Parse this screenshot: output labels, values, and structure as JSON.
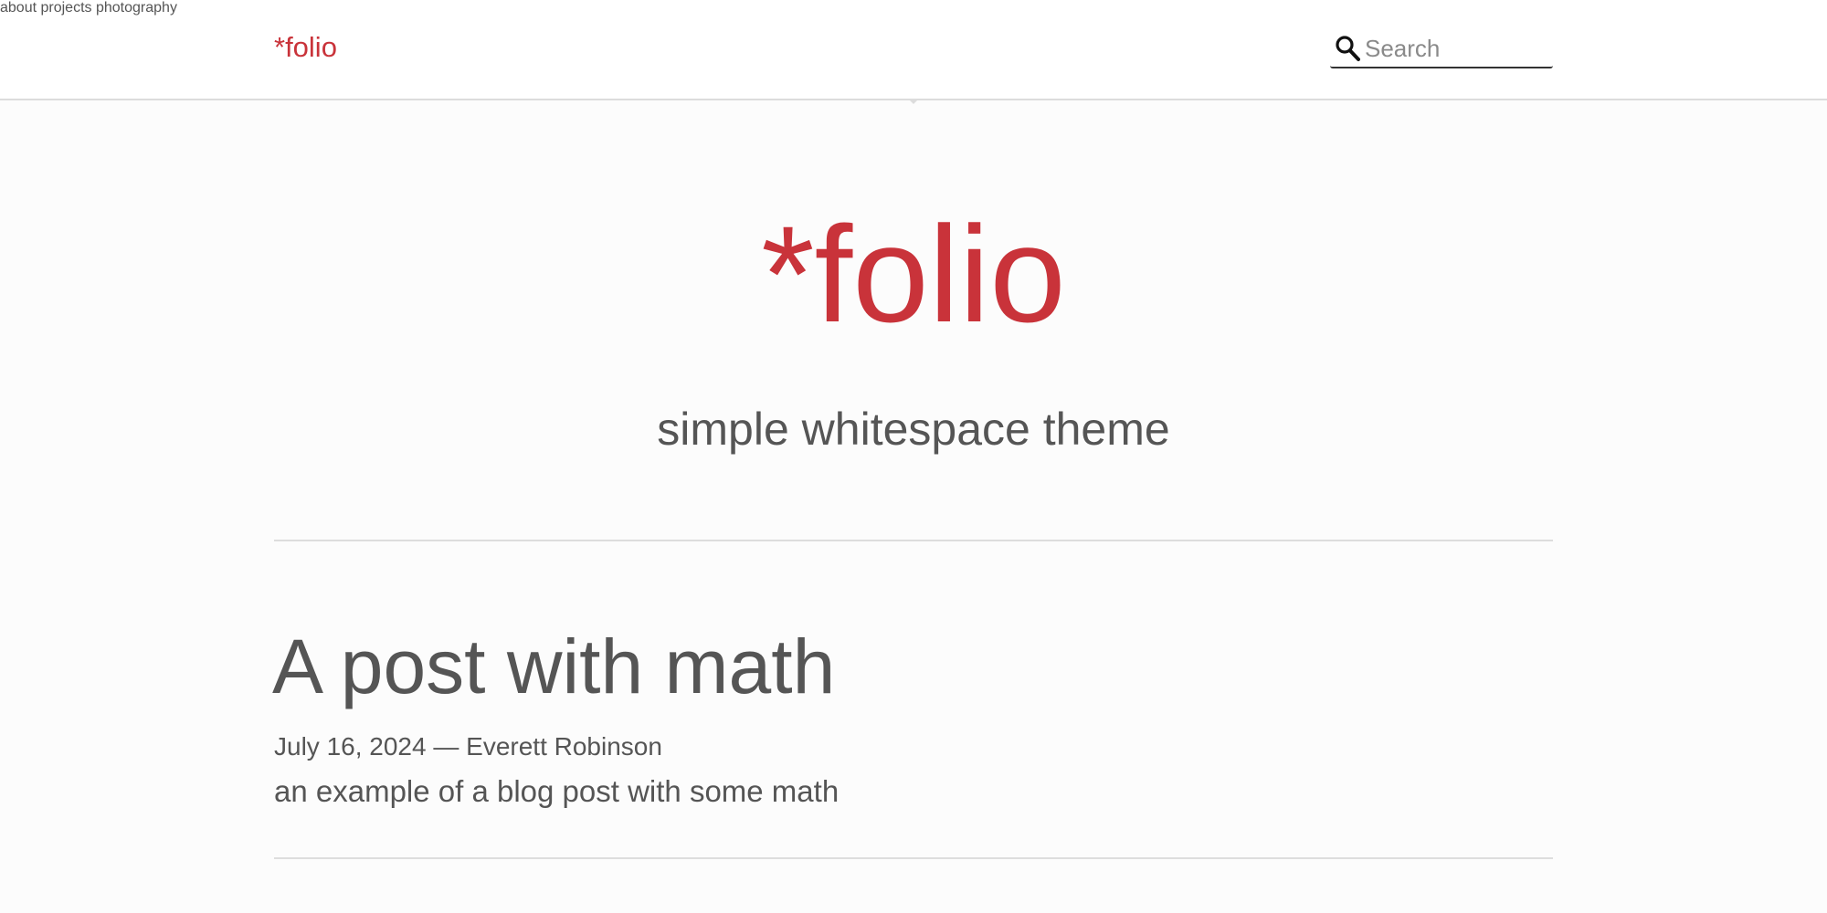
{
  "header": {
    "brand": "*folio",
    "nav": [
      "about",
      "projects",
      "photography"
    ],
    "search_placeholder": "Search"
  },
  "hero": {
    "title": "*folio",
    "subtitle": "simple whitespace theme"
  },
  "posts": [
    {
      "title": "A post with math",
      "date": "July 16, 2024",
      "separator": "—",
      "author": "Everett Robinson",
      "description": "an example of a blog post with some math"
    }
  ],
  "colors": {
    "accent": "#c9333a",
    "text": "#555555",
    "nav_text": "#333333",
    "background": "#fcfcfc",
    "header_background": "#ffffff",
    "divider": "#dddddd"
  },
  "icons": {
    "search": "search-icon"
  }
}
